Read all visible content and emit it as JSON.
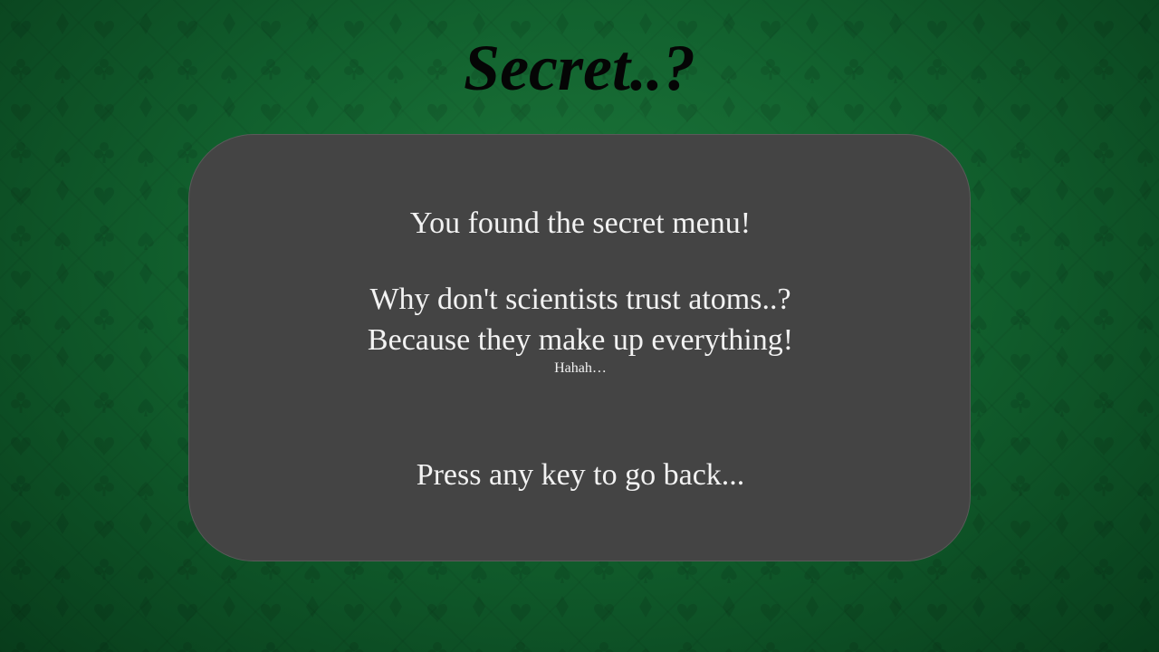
{
  "screen": {
    "title": "Secret..?"
  },
  "panel": {
    "discovery": "You found the secret menu!",
    "joke_question": "Why don't scientists trust atoms..?",
    "joke_answer": "Because they make up everything!",
    "laugh": "Hahah…",
    "prompt": "Press any key to go back..."
  },
  "colors": {
    "background": "#11612f",
    "panel": "#444444",
    "panel_text": "#f2f2f2",
    "title_text": "#050505"
  },
  "icons": {
    "background_pattern": "card-suits-pattern"
  }
}
